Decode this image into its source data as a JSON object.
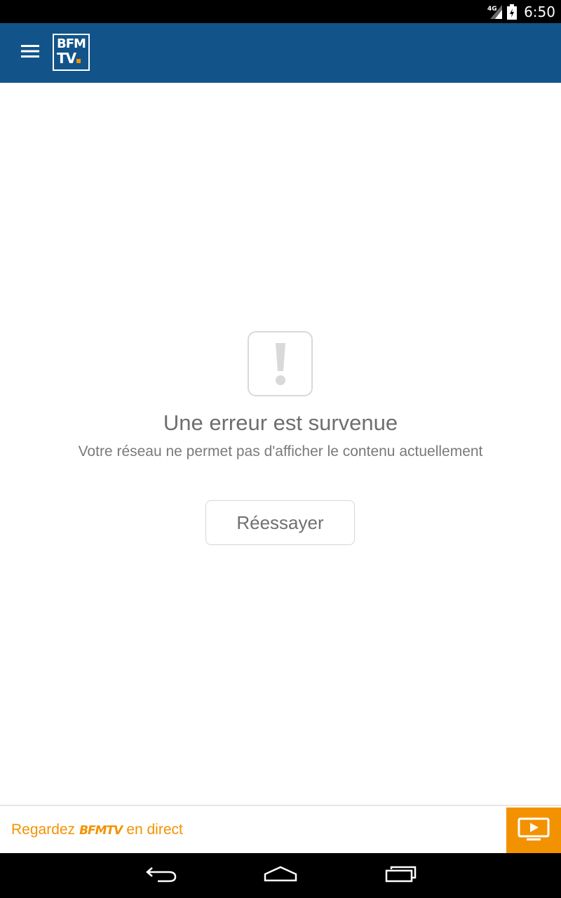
{
  "status_bar": {
    "network": "4G",
    "time": "6:50",
    "icons": [
      "signal-icon",
      "battery-icon"
    ]
  },
  "app_bar": {
    "menu_icon": "hamburger-menu-icon",
    "logo_line1": "BFM",
    "logo_line2": "TV",
    "brand_color": "#12548a"
  },
  "error": {
    "icon": "warning-exclamation-icon",
    "title": "Une erreur est survenue",
    "message": "Votre réseau ne permet pas d'afficher le contenu actuellement",
    "retry_label": "Réessayer"
  },
  "live_banner": {
    "prefix": "Regardez",
    "brand": "BFMTV",
    "suffix": "en direct",
    "button_icon": "tv-play-icon",
    "accent_color": "#f39200"
  },
  "nav_bar": {
    "icons": [
      "back-icon",
      "home-icon",
      "recent-apps-icon"
    ]
  }
}
